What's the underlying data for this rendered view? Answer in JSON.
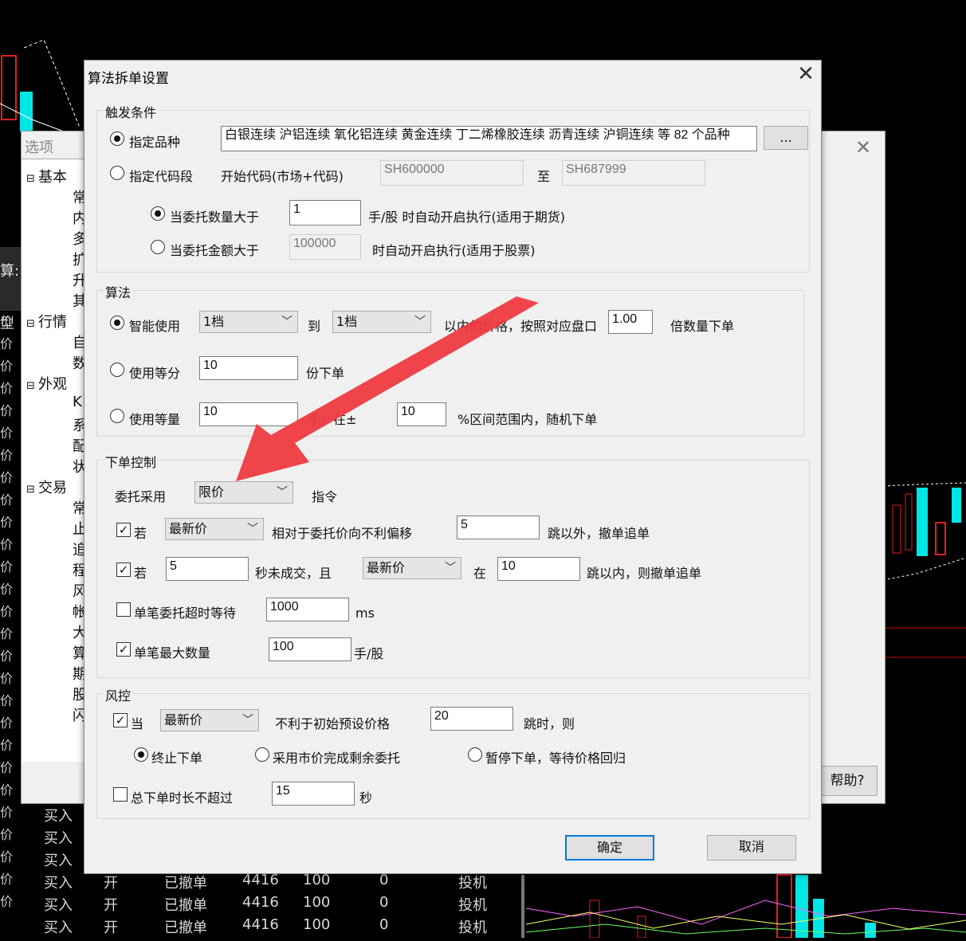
{
  "background": {
    "side_label": "算:",
    "type_label": "型",
    "price_rows": [
      "价",
      "价",
      "价",
      "价",
      "价",
      "价",
      "价",
      "价",
      "价",
      "价",
      "价",
      "价",
      "价",
      "价",
      "价",
      "价",
      "价",
      "价",
      "价",
      "价",
      "价",
      "价",
      "价",
      "价",
      "价",
      "价",
      "价"
    ],
    "orders": [
      {
        "dir": "买入",
        "oc": "",
        "status": "",
        "price": "",
        "qty": "",
        "fill": "",
        "kind": ""
      },
      {
        "dir": "买入",
        "oc": "",
        "status": "",
        "price": "",
        "qty": "",
        "fill": "",
        "kind": ""
      },
      {
        "dir": "买入",
        "oc": "",
        "status": "",
        "price": "",
        "qty": "",
        "fill": "",
        "kind": ""
      },
      {
        "dir": "买入",
        "oc": "开",
        "status": "已撤单",
        "price": "4416",
        "qty": "100",
        "fill": "0",
        "kind": "投机"
      },
      {
        "dir": "买入",
        "oc": "开",
        "status": "已撤单",
        "price": "4416",
        "qty": "100",
        "fill": "0",
        "kind": "投机"
      },
      {
        "dir": "买入",
        "oc": "开",
        "status": "已撤单",
        "price": "4416",
        "qty": "100",
        "fill": "0",
        "kind": "投机"
      }
    ]
  },
  "options_window": {
    "title": "选项",
    "help_label": "帮助?",
    "tree": [
      {
        "label": "基本",
        "level": 0
      },
      {
        "label": "常",
        "level": 1
      },
      {
        "label": "内",
        "level": 1
      },
      {
        "label": "多",
        "level": 1
      },
      {
        "label": "扩",
        "level": 1
      },
      {
        "label": "升",
        "level": 1
      },
      {
        "label": "其",
        "level": 1
      },
      {
        "label": "行情",
        "level": 0
      },
      {
        "label": "自",
        "level": 1
      },
      {
        "label": "数",
        "level": 1
      },
      {
        "label": "外观",
        "level": 0
      },
      {
        "label": "K",
        "level": 1
      },
      {
        "label": "系",
        "level": 1
      },
      {
        "label": "配",
        "level": 1
      },
      {
        "label": "状",
        "level": 1
      },
      {
        "label": "交易",
        "level": 0
      },
      {
        "label": "常",
        "level": 1
      },
      {
        "label": "止",
        "level": 1
      },
      {
        "label": "追",
        "level": 1
      },
      {
        "label": "程",
        "level": 1
      },
      {
        "label": "风",
        "level": 1
      },
      {
        "label": "帐",
        "level": 1
      },
      {
        "label": "大",
        "level": 1
      },
      {
        "label": "算",
        "level": 1
      },
      {
        "label": "期",
        "level": 1
      },
      {
        "label": "股",
        "level": 1
      },
      {
        "label": "闪",
        "level": 1
      }
    ]
  },
  "dialog": {
    "title": "算法拆单设置",
    "trigger": {
      "group_label": "触发条件",
      "specified_variety_label": "指定品种",
      "variety_list": "白银连续 沪铝连续 氧化铝连续 黄金连续 丁二烯橡胶连续 沥青连续 沪铜连续 等 82 个品种",
      "browse_label": "...",
      "code_range_label": "指定代码段",
      "start_code_label": "开始代码(市场+代码)",
      "start_code": "SH600000",
      "to_label": "至",
      "end_code": "SH687999",
      "qty_gt_label": "当委托数量大于",
      "qty_gt_value": "1",
      "qty_gt_suffix": "手/股 时自动开启执行(适用于期货)",
      "amt_gt_label": "当委托金额大于",
      "amt_gt_value": "100000",
      "amt_gt_suffix": "时自动开启执行(适用于股票)"
    },
    "algo": {
      "group_label": "算法",
      "smart_label": "智能使用",
      "level_from": "1档",
      "to_label": "到",
      "level_to": "1档",
      "within_label": "以内的价格，按照对应盘口",
      "multiplier": "1.00",
      "multiplier_suffix": "倍数量下单",
      "equal_parts_label": "使用等分",
      "equal_parts_value": "10",
      "equal_parts_suffix": "份下单",
      "equal_qty_label": "使用等量",
      "equal_qty_value": "10",
      "equal_qty_mid": "手，在±",
      "range_value": "10",
      "range_suffix": "%区间范围内，随机下单"
    },
    "order_ctrl": {
      "group_label": "下单控制",
      "entrust_label": "委托采用",
      "entrust_type": "限价",
      "instruction_label": "指令",
      "if_label": "若",
      "price_ref_1": "最新价",
      "offset_label": "相对于委托价向不利偏移",
      "offset_value": "5",
      "offset_suffix": "跳以外，撤单追单",
      "if2_label": "若",
      "seconds_value": "5",
      "seconds_label": "秒未成交，且",
      "price_ref_2": "最新价",
      "in_label": "在",
      "ticks_value": "10",
      "ticks_suffix": "跳以内，则撤单追单",
      "timeout_label": "单笔委托超时等待",
      "timeout_value": "1000",
      "timeout_unit": "ms",
      "max_qty_label": "单笔最大数量",
      "max_qty_value": "100",
      "max_qty_unit": "手/股"
    },
    "risk": {
      "group_label": "风控",
      "when_label": "当",
      "price_ref": "最新价",
      "adverse_label": "不利于初始预设价格",
      "ticks_value": "20",
      "ticks_suffix": "跳时，则",
      "stop_label": "终止下单",
      "market_label": "采用市价完成剩余委托",
      "pause_label": "暂停下单，等待价格回归",
      "total_time_label": "总下单时长不超过",
      "total_time_value": "15",
      "total_time_unit": "秒"
    },
    "ok_label": "确定",
    "cancel_label": "取消"
  },
  "colors": {
    "accent_arrow": "#ee3a3f",
    "focus_border": "#0078d7",
    "chart_cyan": "#00e5e5",
    "chart_red": "#e02020"
  }
}
